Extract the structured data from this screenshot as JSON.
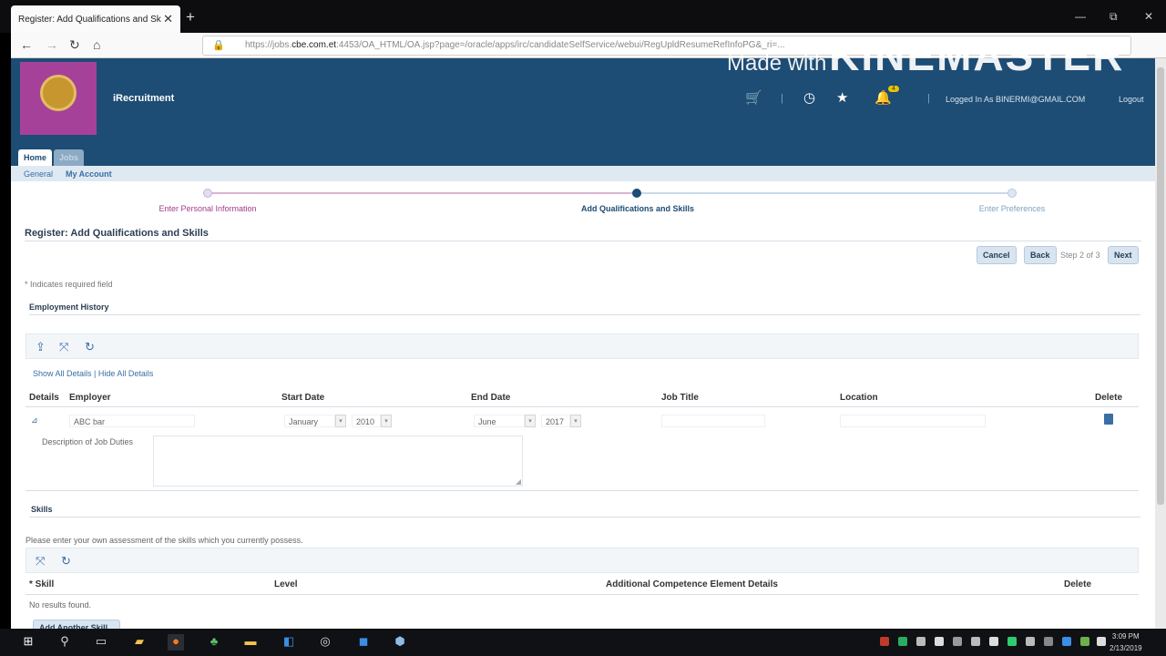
{
  "browser": {
    "tab_title": "Register: Add Qualifications and Sk",
    "tab_close": "✕",
    "new_tab": "+",
    "url_prefix": "https://jobs.",
    "url_domain": "cbe.com.et",
    "url_rest": ":4453/OA_HTML/OA.jsp?page=/oracle/apps/irc/candidateSelfService/webui/RegUpldResumeRefInfoPG&_ri=...",
    "window_controls": [
      "—",
      "⧉",
      "✕"
    ]
  },
  "watermark": {
    "prefix": "Made with",
    "brand": "KINEMASTER"
  },
  "header": {
    "app_title": "iRecruitment",
    "notification_count": "4",
    "logged_in": "Logged In As BINERMI@GMAIL.COM",
    "logout": "Logout",
    "tabs": [
      "Home",
      "Jobs"
    ],
    "subnav": [
      "General",
      "My Account"
    ]
  },
  "train": {
    "steps": [
      "Enter Personal Information",
      "Add Qualifications and Skills",
      "Enter Preferences"
    ]
  },
  "page_title": "Register: Add Qualifications and Skills",
  "actions": {
    "cancel": "Cancel",
    "back": "Back",
    "step": "Step 2 of 3",
    "next": "Next"
  },
  "required_note": "* Indicates required field",
  "employment": {
    "section_title": "Employment History",
    "show_hide": "Show All Details | Hide All Details",
    "columns": [
      "Details",
      "Employer",
      "Start Date",
      "End Date",
      "Job Title",
      "Location",
      "Delete"
    ],
    "row": {
      "employer": "ABC bar",
      "start_month": "January",
      "start_year": "2010",
      "end_month": "June",
      "end_year": "2017",
      "job_title": "",
      "location": ""
    },
    "description_label": "Description of Job Duties"
  },
  "skills": {
    "section_title": "Skills",
    "instructions": "Please enter your own assessment of the skills which you currently possess.",
    "columns": [
      "* Skill",
      "Level",
      "Additional Competence Element Details",
      "Delete"
    ],
    "empty": "No results found.",
    "add_button": "Add Another Skill"
  },
  "clock": {
    "time": "3:09 PM",
    "date": "2/13/2019"
  }
}
